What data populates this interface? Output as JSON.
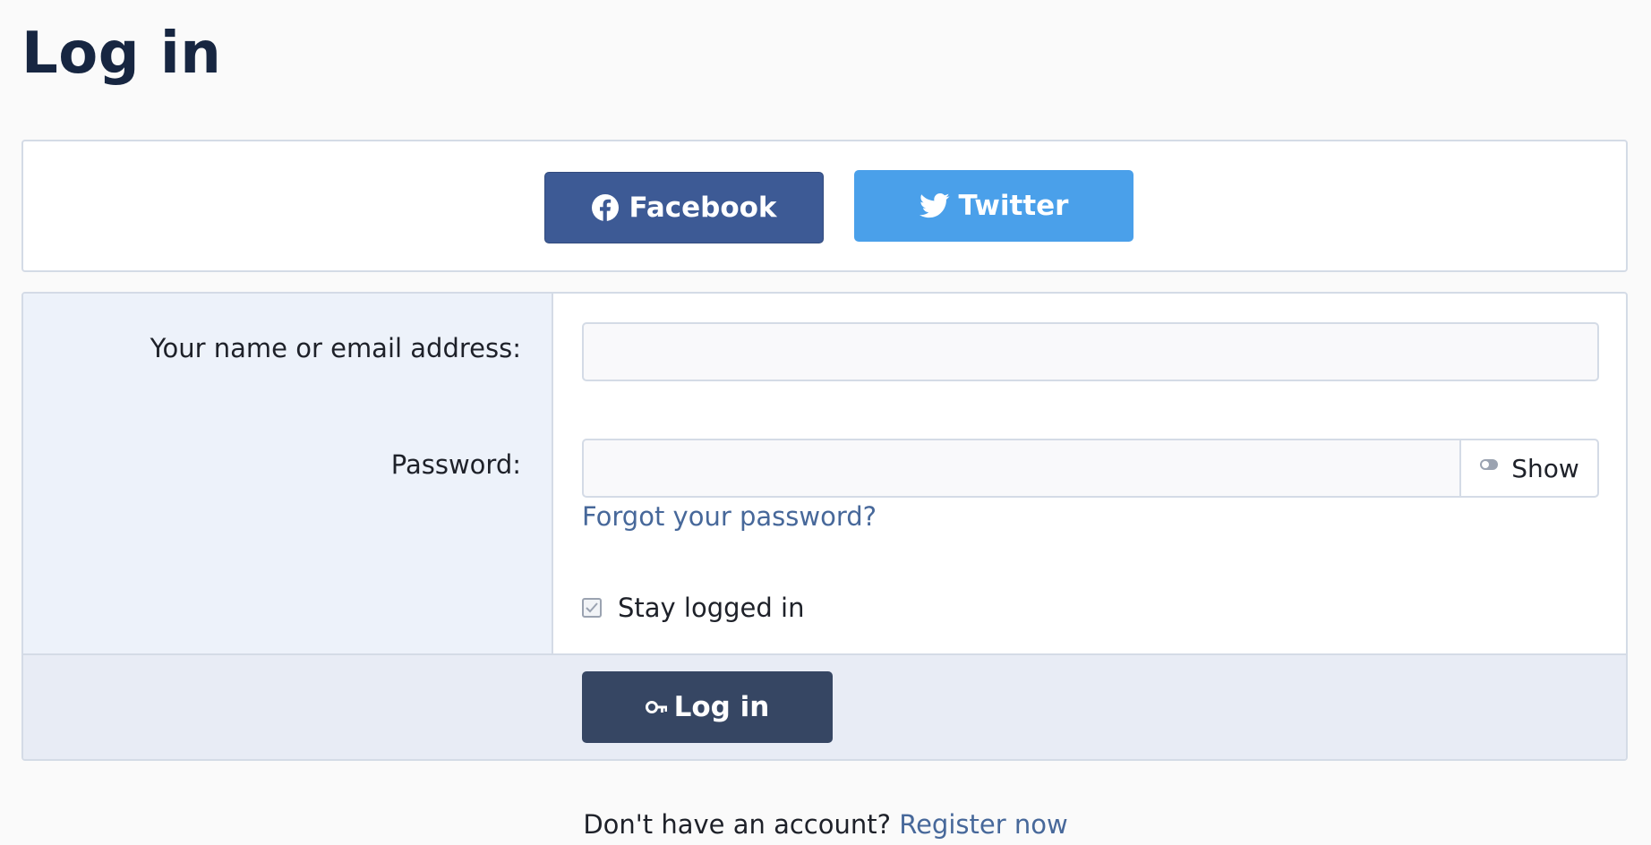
{
  "page": {
    "title": "Log in"
  },
  "social": {
    "facebook_label": "Facebook",
    "facebook_icon": "facebook-icon",
    "facebook_color": "#3d5a95",
    "twitter_label": "Twitter",
    "twitter_icon": "twitter-icon",
    "twitter_color": "#4aa0ea"
  },
  "form": {
    "name_label": "Your name or email address:",
    "name_value": "",
    "password_label": "Password:",
    "password_value": "",
    "show_label": "Show",
    "show_icon": "toggle-icon",
    "forgot_label": "Forgot your password?",
    "stay_logged_in_label": "Stay logged in",
    "stay_logged_in_checked": true,
    "submit_label": "Log in",
    "submit_icon": "key-icon",
    "submit_color": "#364663"
  },
  "register": {
    "prompt": "Don't have an account?",
    "link_label": "Register now"
  }
}
